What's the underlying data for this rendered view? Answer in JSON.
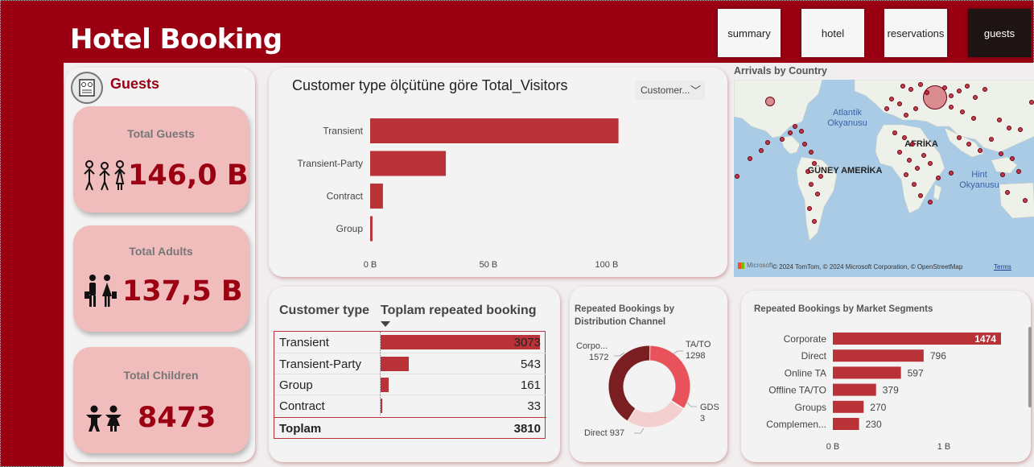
{
  "header": {
    "title": "Hotel Booking",
    "nav": [
      "summary",
      "hotel",
      "reservations",
      "guests"
    ],
    "active_nav": "guests"
  },
  "guests_panel": {
    "title": "Guests",
    "kpis": [
      {
        "label": "Total Guests",
        "value": "146,0 B"
      },
      {
        "label": "Total Adults",
        "value": "137,5 B"
      },
      {
        "label": "Total Children",
        "value": "8473"
      }
    ]
  },
  "visitors_chart": {
    "title": "Customer type ölçütüne göre Total_Visitors",
    "filter_label": "Customer...",
    "chart_data": {
      "type": "bar",
      "orientation": "horizontal",
      "categories": [
        "Transient",
        "Transient-Party",
        "Contract",
        "Group"
      ],
      "values": [
        105,
        32,
        5.4,
        1.0
      ],
      "unit": "B",
      "xlim": [
        0,
        115
      ],
      "xticks": [
        "0 B",
        "50 B",
        "100 B"
      ]
    }
  },
  "map": {
    "title": "Arrivals by Country",
    "labels": {
      "atlantic": "Atlantik Okyanusu",
      "africa": "AFRİKA",
      "south_america": "GÜNEY AMERİKA",
      "indian": "Hint Okyanusu"
    },
    "attribution": "© 2024 TomTom, © 2024 Microsoft Corporation, © OpenStreetMap",
    "terms": "Terms",
    "logo": "Microsoft"
  },
  "repeated_table": {
    "col1": "Customer type",
    "col2": "Toplam repeated booking",
    "rows": [
      {
        "type": "Transient",
        "value": "3073",
        "num": 3073
      },
      {
        "type": "Transient-Party",
        "value": "543",
        "num": 543
      },
      {
        "type": "Group",
        "value": "161",
        "num": 161
      },
      {
        "type": "Contract",
        "value": "33",
        "num": 33
      }
    ],
    "total_label": "Toplam",
    "total_value": "3810"
  },
  "distribution_chart": {
    "title": "Repeated Bookings by Distribution Channel",
    "chart_data": {
      "type": "pie",
      "donut": true,
      "slices": [
        {
          "name": "TA/TO",
          "value": 1298,
          "color": "#e8525a"
        },
        {
          "name": "GDS",
          "value": 3,
          "color": "#f6c6c6"
        },
        {
          "name": "Direct",
          "value": 937,
          "color": "#f3cfcf"
        },
        {
          "name": "Corporate",
          "value": 1572,
          "color": "#7a1e22"
        }
      ],
      "labels": [
        "Corpo...",
        "1572",
        "TA/TO",
        "1298",
        "GDS",
        "3",
        "Direct 937"
      ]
    }
  },
  "segments_chart": {
    "title": "Repeated Bookings by Market Segments",
    "chart_data": {
      "type": "bar",
      "orientation": "horizontal",
      "categories": [
        "Corporate",
        "Direct",
        "Online TA",
        "Offline TA/TO",
        "Groups",
        "Complemen..."
      ],
      "values": [
        1474,
        796,
        597,
        379,
        270,
        230
      ],
      "value_labels": [
        "1474",
        "796",
        "597",
        "379",
        "270",
        "230"
      ],
      "xlim": [
        0,
        1700
      ],
      "xticks": [
        "0 B",
        "1 B"
      ]
    }
  },
  "colors": {
    "brand": "#9b0012",
    "bar": "#b83238",
    "kpi_bg": "#f1bcbc"
  }
}
